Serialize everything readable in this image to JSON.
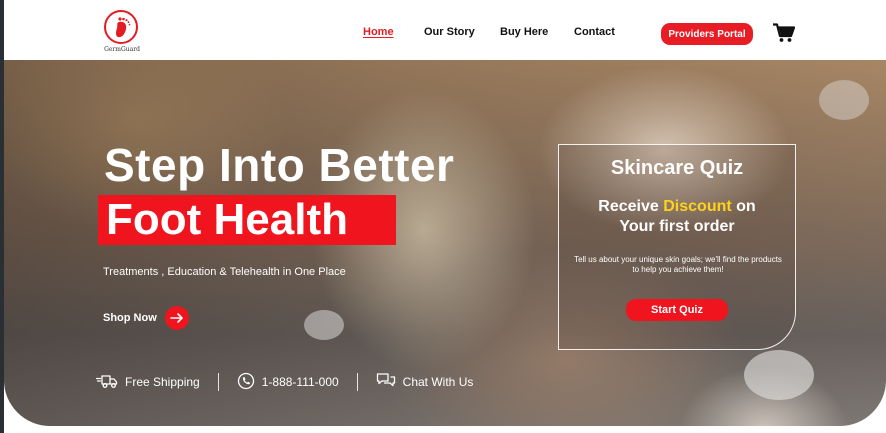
{
  "brand": {
    "name": "GermGuard",
    "accent_color": "#e81c24",
    "highlight_color": "#ffd21a"
  },
  "nav": {
    "items": [
      {
        "label": "Home",
        "active": true
      },
      {
        "label": "Our Story",
        "active": false
      },
      {
        "label": "Buy Here",
        "active": false
      },
      {
        "label": "Contact",
        "active": false
      }
    ],
    "portal_label": "Providers Portal",
    "cart_icon": "shopping-cart-icon"
  },
  "hero": {
    "headline_line1": "Step Into Better",
    "headline_line2": "Foot Health",
    "subheading": "Treatments , Education & Telehealth in One Place",
    "shop_label": "Shop Now",
    "features": [
      {
        "icon": "delivery-truck-icon",
        "label": "Free Shipping"
      },
      {
        "icon": "phone-icon",
        "label": "1-888-111-000"
      },
      {
        "icon": "chat-icon",
        "label": "Chat With Us"
      }
    ]
  },
  "quiz": {
    "title": "Skincare Quiz",
    "offer_prefix": "Receive",
    "offer_highlight": "Discount",
    "offer_suffix": "on",
    "offer_line2": "Your first order",
    "description": "Tell us about your unique skin goals; we'll find the products to help you achieve them!",
    "button_label": "Start Quiz"
  }
}
